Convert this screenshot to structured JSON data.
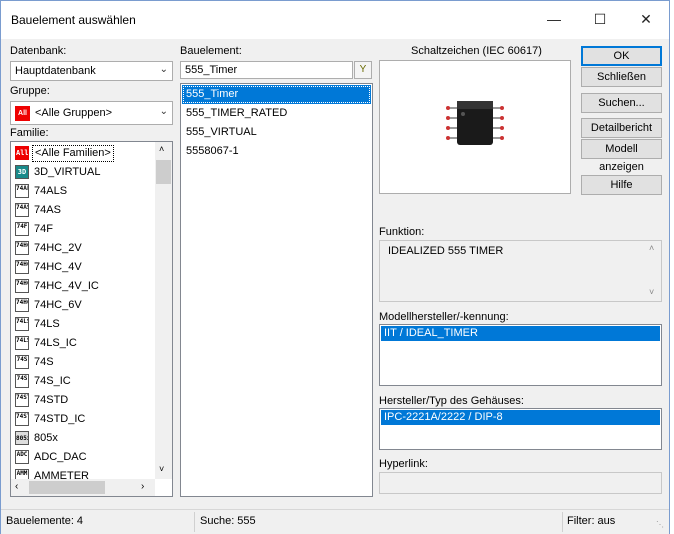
{
  "window": {
    "title": "Bauelement auswählen",
    "minimize_glyph": "—",
    "maximize_glyph": "☐",
    "close_glyph": "✕"
  },
  "left": {
    "datenbank_label": "Datenbank:",
    "datenbank_value": "Hauptdatenbank",
    "gruppe_label": "Gruppe:",
    "gruppe_value": "<Alle Gruppen>",
    "gruppe_icon": "All",
    "familie_label": "Familie:",
    "familien": [
      {
        "icon": "All",
        "label": "<Alle Familien>"
      },
      {
        "icon": "3D",
        "label": "3D_VIRTUAL"
      },
      {
        "icon": "74ALS",
        "label": "74ALS"
      },
      {
        "icon": "74AS",
        "label": "74AS"
      },
      {
        "icon": "74F",
        "label": "74F"
      },
      {
        "icon": "74HC",
        "label": "74HC_2V"
      },
      {
        "icon": "74HC",
        "label": "74HC_4V"
      },
      {
        "icon": "74HC",
        "label": "74HC_4V_IC"
      },
      {
        "icon": "74HC",
        "label": "74HC_6V"
      },
      {
        "icon": "74LS",
        "label": "74LS"
      },
      {
        "icon": "74LS",
        "label": "74LS_IC"
      },
      {
        "icon": "74S",
        "label": "74S"
      },
      {
        "icon": "74S",
        "label": "74S_IC"
      },
      {
        "icon": "74STD",
        "label": "74STD"
      },
      {
        "icon": "74STD",
        "label": "74STD_IC"
      },
      {
        "icon": "805x",
        "label": "805x"
      },
      {
        "icon": "ADC",
        "label": "ADC_DAC"
      },
      {
        "icon": "AMM",
        "label": "AMMETER"
      }
    ]
  },
  "middle": {
    "bauelement_label": "Bauelement:",
    "search_value": "555_Timer",
    "filter_icon": "Y",
    "items": [
      "555_Timer",
      "555_TIMER_RATED",
      "555_VIRTUAL",
      "5558067-1"
    ]
  },
  "right": {
    "schaltzeichen_label": "Schaltzeichen (IEC 60617)",
    "funktion_label": "Funktion:",
    "funktion_value": "IDEALIZED 555 TIMER",
    "modell_label": "Modellhersteller/-kennung:",
    "modell_value": "IIT / IDEAL_TIMER",
    "hersteller_label": "Hersteller/Typ des Gehäuses:",
    "hersteller_value": "IPC-2221A/2222 / DIP-8",
    "hyperlink_label": "Hyperlink:"
  },
  "buttons": {
    "ok": "OK",
    "schliessen": "Schließen",
    "suchen": "Suchen...",
    "detailbericht": "Detailbericht",
    "modell_anzeigen": "Modell anzeigen",
    "hilfe": "Hilfe"
  },
  "status": {
    "bauelemente": "Bauelemente: 4",
    "suche": "Suche: 555",
    "filter": "Filter: aus"
  }
}
